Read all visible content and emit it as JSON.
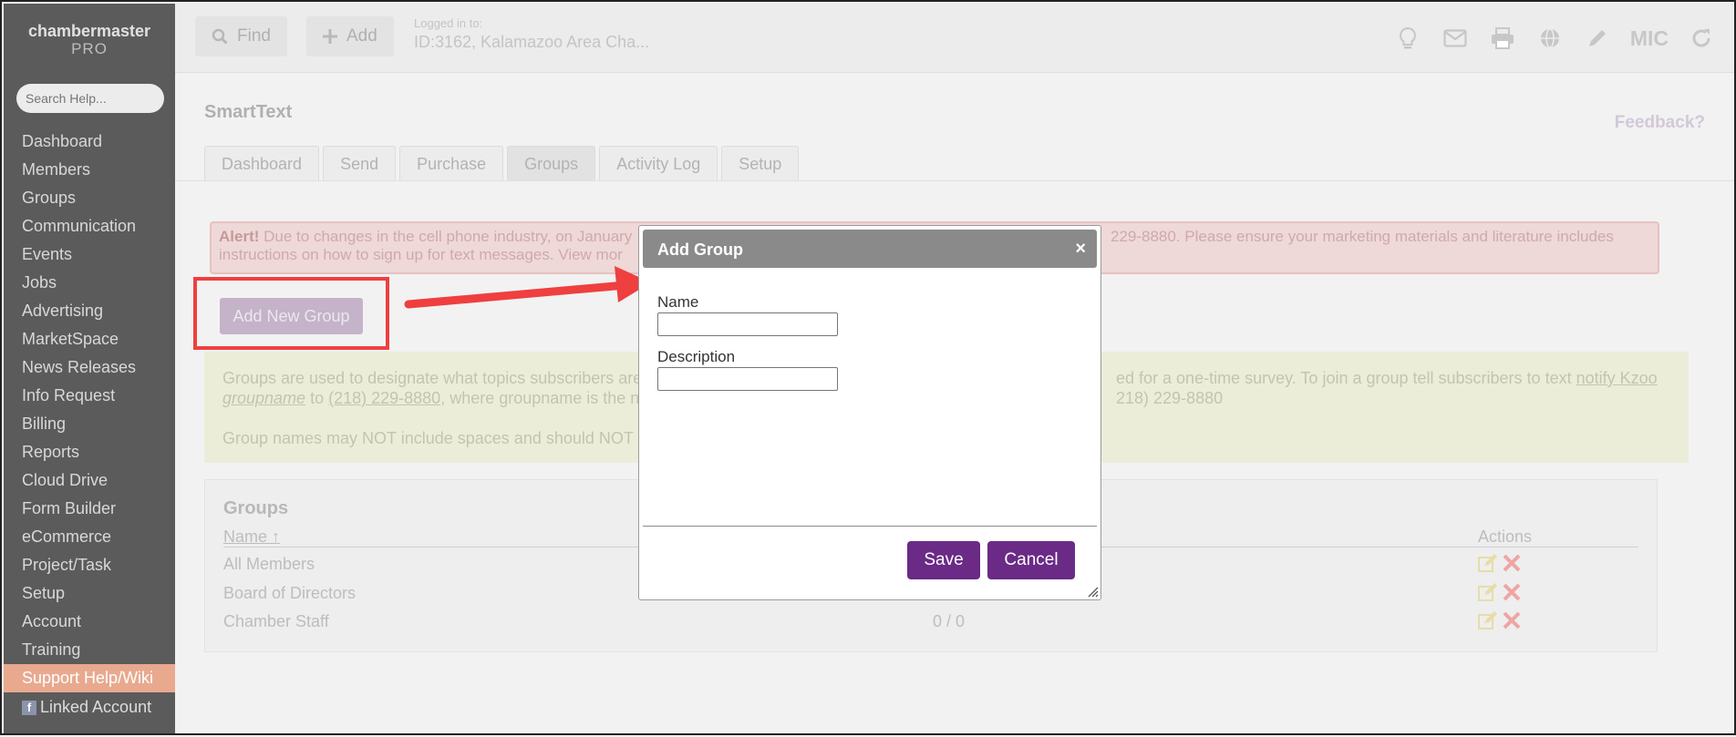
{
  "sidebar": {
    "logo_main": "chambermaster",
    "logo_sub": "PRO",
    "search_placeholder": "Search Help...",
    "items": [
      {
        "label": "Dashboard"
      },
      {
        "label": "Members"
      },
      {
        "label": "Groups"
      },
      {
        "label": "Communication"
      },
      {
        "label": "Events"
      },
      {
        "label": "Jobs"
      },
      {
        "label": "Advertising"
      },
      {
        "label": "MarketSpace"
      },
      {
        "label": "News Releases"
      },
      {
        "label": "Info Request"
      },
      {
        "label": "Billing"
      },
      {
        "label": "Reports"
      },
      {
        "label": "Cloud Drive"
      },
      {
        "label": "Form Builder"
      },
      {
        "label": "eCommerce"
      },
      {
        "label": "Project/Task"
      },
      {
        "label": "Setup"
      },
      {
        "label": "Account"
      },
      {
        "label": "Training"
      },
      {
        "label": "Support Help/Wiki"
      }
    ],
    "linked_account": "Linked Account"
  },
  "topbar": {
    "find_label": "Find",
    "add_label": "Add",
    "logged_in_label": "Logged in to:",
    "logged_in_value": "ID:3162, Kalamazoo Area Cha...",
    "mic_label": "MIC"
  },
  "page": {
    "title": "SmartText",
    "feedback": "Feedback?",
    "tabs": [
      {
        "label": "Dashboard"
      },
      {
        "label": "Send"
      },
      {
        "label": "Purchase"
      },
      {
        "label": "Groups"
      },
      {
        "label": "Activity Log"
      },
      {
        "label": "Setup"
      }
    ],
    "active_tab": "Groups"
  },
  "alert": {
    "strong": "Alert!",
    "line1_left": "Due to changes in the cell phone industry, on January",
    "line1_right": "229-8880. Please ensure your marketing materials and literature includes",
    "line2_left": "instructions on how to sign up for text messages. View mor"
  },
  "add_new_group_label": "Add New Group",
  "info": {
    "line1_left": "Groups are used to designate what topics subscribers are i",
    "line1_right_pre": "ed for a one-time survey. To join a group tell subscribers to text ",
    "line1_right_link": "notify Kzoo",
    "line2_left_link1": "groupname",
    "line2_left_mid": " to ",
    "line2_left_link2": "(218) 229-8880",
    "line2_left_post": ", where groupname is the nar",
    "line2_right": "218) 229-8880",
    "line3_left": "Group names may NOT include spaces and should NOT be"
  },
  "groups": {
    "title": "Groups",
    "col_name": "Name ↑",
    "col_actions": "Actions",
    "rows": [
      {
        "name": "All Members",
        "count": ""
      },
      {
        "name": "Board of Directors",
        "count": ""
      },
      {
        "name": "Chamber Staff",
        "count": "0 / 0"
      }
    ]
  },
  "dialog": {
    "title": "Add Group",
    "close": "×",
    "name_label": "Name",
    "name_value": "",
    "description_label": "Description",
    "description_value": "",
    "save_label": "Save",
    "cancel_label": "Cancel"
  },
  "colors": {
    "accent": "#6a2a86",
    "highlight": "#ef3f3f",
    "dialog_header": "#8a8a8a"
  }
}
